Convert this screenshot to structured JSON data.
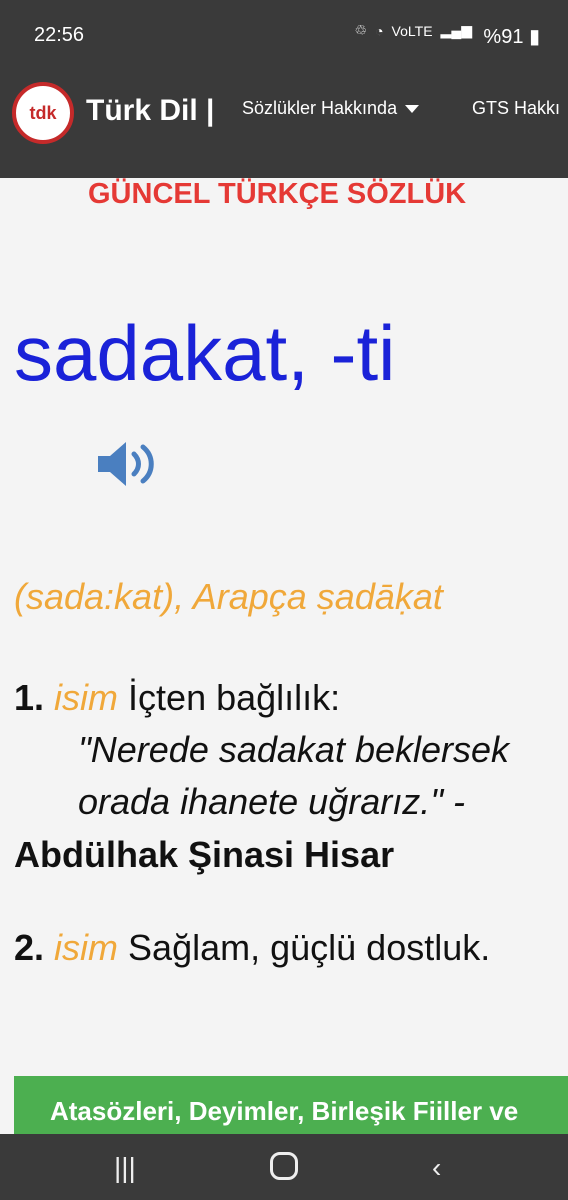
{
  "status_bar": {
    "time": "22:56",
    "icons": [
      "recycle-icon",
      "wifi-icon",
      "volte-icon",
      "signal-icon"
    ],
    "battery": "%91"
  },
  "header": {
    "brand": "Türk Dil |",
    "menu": [
      "Sözlükler Hakkında",
      "GTS Hakkı"
    ]
  },
  "dictionary": {
    "title": "GÜNCEL TÜRKÇE SÖZLÜK",
    "headword": "sadakat, -ti",
    "etymology": "(sada:kat), Arapça ṣadāḳat",
    "senses": [
      {
        "number": "1.",
        "pos": "isim",
        "definition": "İçten bağlılık:",
        "quote": "\"Nerede sadakat beklersek orada ihanete uğrarız.\" -",
        "author": "Abdülhak Şinasi Hisar"
      },
      {
        "number": "2.",
        "pos": "isim",
        "definition": "Sağlam, güçlü dostluk."
      }
    ],
    "related_banner": "Atasözleri, Deyimler, Birleşik Fiiller ve"
  },
  "system_nav": {
    "recent": "|||",
    "home": "",
    "back": "‹"
  }
}
